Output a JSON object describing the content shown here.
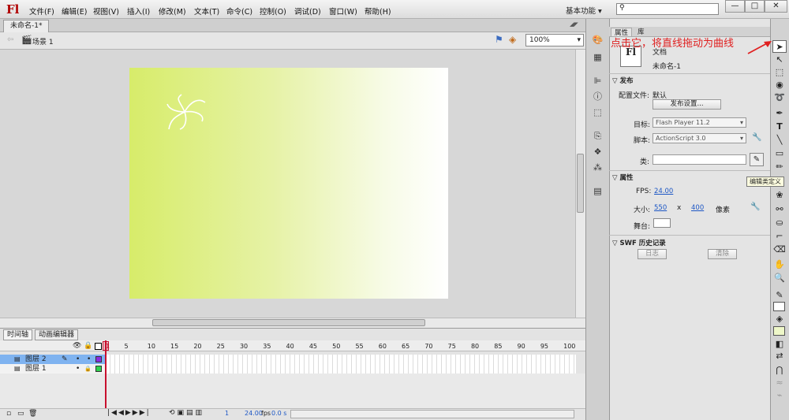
{
  "app": {
    "logo": "Fl"
  },
  "menu": [
    "文件(F)",
    "编辑(E)",
    "视图(V)",
    "插入(I)",
    "修改(M)",
    "文本(T)",
    "命令(C)",
    "控制(O)",
    "调试(D)",
    "窗口(W)",
    "帮助(H)"
  ],
  "workspace": "基本功能",
  "window_controls": [
    "—",
    "□",
    "✕"
  ],
  "document_tab": "未命名-1*",
  "scene": {
    "label": "场景 1",
    "zoom": "100%"
  },
  "timeline": {
    "tabs": [
      "时间轴",
      "动画编辑器"
    ],
    "frame_numbers": [
      "1",
      "5",
      "10",
      "15",
      "20",
      "25",
      "30",
      "35",
      "40",
      "45",
      "50",
      "55",
      "60",
      "65",
      "70",
      "75",
      "80",
      "85",
      "90",
      "95",
      "100"
    ],
    "layers": [
      {
        "name": "图层 2",
        "selected": true
      },
      {
        "name": "图层 1",
        "selected": false
      }
    ],
    "footer": {
      "current_frame": "1",
      "fps": "24.00",
      "fps_unit": "fps",
      "time": "0.0 s"
    }
  },
  "properties": {
    "tabs": [
      "属性",
      "库"
    ],
    "doc_icon": "Fl",
    "doc_type": "文档",
    "doc_name": "未命名-1",
    "publish": {
      "section": "发布",
      "profile_label": "配置文件:",
      "profile_value": "默认",
      "settings_button": "发布设置...",
      "target_label": "目标:",
      "target_value": "Flash Player 11.2",
      "script_label": "脚本:",
      "script_value": "ActionScript 3.0",
      "class_label": "类:",
      "class_value": ""
    },
    "props": {
      "section": "属性",
      "fps_label": "FPS:",
      "fps_value": "24.00",
      "size_label": "大小:",
      "width": "550",
      "x": "x",
      "height": "400",
      "unit": "像素",
      "stage_label": "舞台:"
    },
    "swf": {
      "section": "SWF 历史记录",
      "log_button": "日志",
      "clear_button": "清除"
    }
  },
  "tooltip": "编辑类定义",
  "annotation": "点击它，将直线拖动为曲线",
  "colors": {
    "stage_left": "#d7ec6a",
    "stage_right": "#ffffff",
    "selected_layer": "#7fb3f0",
    "annotation": "#e02020",
    "playhead": "#c8102e",
    "accent_link": "#1d57c5"
  },
  "icons": [
    "selection-tool-icon",
    "subselection-tool-icon",
    "free-transform-icon",
    "3d-rotation-icon",
    "lasso-icon",
    "pen-icon",
    "text-icon",
    "line-icon",
    "rectangle-icon",
    "pencil-icon",
    "brush-icon",
    "deco-icon",
    "bone-icon",
    "paint-bucket-icon",
    "eyedropper-icon",
    "eraser-icon",
    "hand-icon",
    "zoom-icon",
    "stroke-color-icon",
    "fill-color-icon"
  ]
}
